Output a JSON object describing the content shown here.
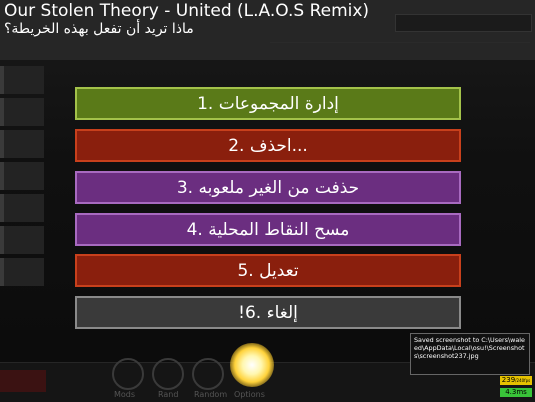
{
  "dialog": {
    "title": "Our Stolen Theory - United (L.A.O.S Remix)",
    "question": "ماذا تريد أن تفعل بهذه الخريطة؟",
    "options": [
      {
        "label": "إدارة المجموعات .1",
        "color": "#5a7a18"
      },
      {
        "label": "...احذف .2",
        "color": "#8a1f0d"
      },
      {
        "label": "حذفت من الغير ملعوبه .3",
        "color": "#6b2e80"
      },
      {
        "label": "مسح النقاط المحلية .4",
        "color": "#6b2e80"
      },
      {
        "label": "تعديل .5",
        "color": "#8a1f0d"
      },
      {
        "label": "إلغاء .6!",
        "color": "#3a3a3a"
      }
    ]
  },
  "notification": {
    "text": "Saved screenshot to C:\\Users\\waleed\\AppData\\Local\\osu!\\Screenshots\\screenshot237.jpg"
  },
  "perf": {
    "fps": "239",
    "fps_suffix": "/240fps",
    "frametime": "4.3ms"
  },
  "footer": {
    "labels": [
      "Mods",
      "Rand",
      "Random",
      "Options"
    ]
  }
}
